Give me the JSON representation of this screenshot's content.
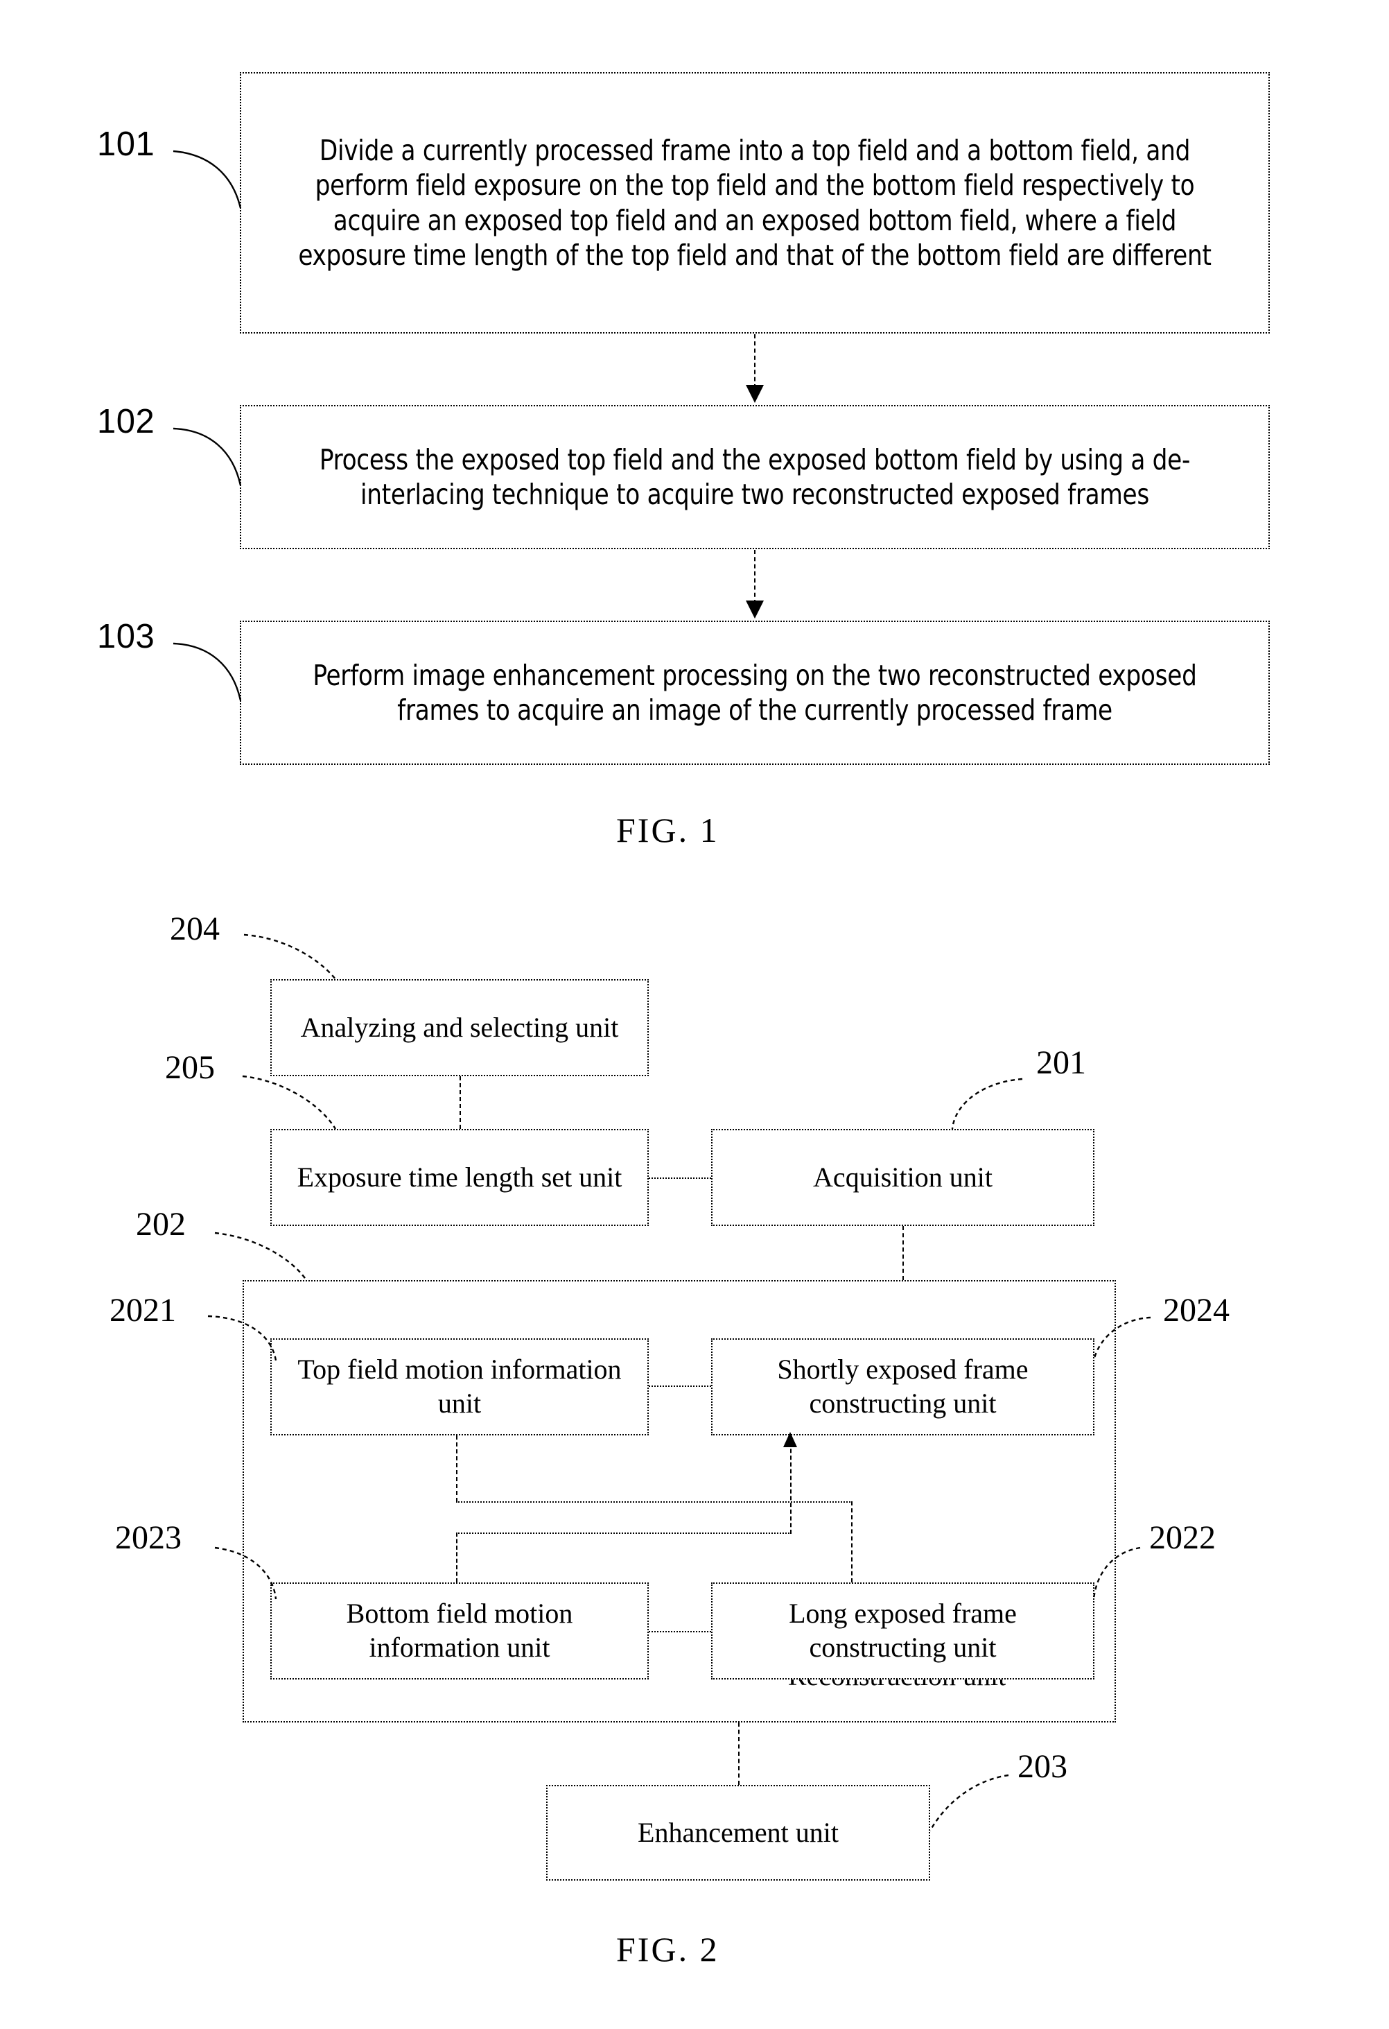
{
  "document": {
    "type": "patent-figure-sheet",
    "figures": [
      {
        "caption": "FIG. 1",
        "kind": "flowchart",
        "steps": [
          {
            "ref": "101",
            "text": "Divide a currently processed frame into a top field and a bottom field, and perform field exposure on the top field and the bottom field respectively to acquire an exposed top field and an exposed bottom field, where a field exposure time length of the top field and that of the bottom field are different"
          },
          {
            "ref": "102",
            "text": "Process the exposed top field and the exposed bottom field by using a de-interlacing technique to acquire two reconstructed exposed frames"
          },
          {
            "ref": "103",
            "text": "Perform image enhancement processing on the two reconstructed exposed frames to acquire an image of the currently processed frame"
          }
        ]
      },
      {
        "caption": "FIG. 2",
        "kind": "block-diagram",
        "blocks": [
          {
            "ref": "204",
            "label": "Analyzing and selecting unit"
          },
          {
            "ref": "205",
            "label": "Exposure time length set unit"
          },
          {
            "ref": "201",
            "label": "Acquisition unit"
          },
          {
            "ref": "202",
            "label": "Reconstruction unit"
          },
          {
            "ref": "2021",
            "label": "Top field motion information unit"
          },
          {
            "ref": "2024",
            "label": "Shortly exposed frame constructing unit"
          },
          {
            "ref": "2023",
            "label": "Bottom field motion information unit"
          },
          {
            "ref": "2022",
            "label": "Long exposed frame constructing unit"
          },
          {
            "ref": "203",
            "label": "Enhancement unit"
          }
        ]
      }
    ]
  },
  "fig1": {
    "caption": "FIG. 1",
    "step1_ref": "101",
    "step1_text": "Divide a currently processed frame into a top field and a bottom field, and perform field exposure on the top field and the bottom field respectively to acquire an exposed top field and an exposed bottom field, where a field exposure time length of the top field and that of the bottom field are different",
    "step2_ref": "102",
    "step2_text": "Process the exposed top field and the exposed bottom field by using a de-interlacing technique to acquire two reconstructed exposed frames",
    "step3_ref": "103",
    "step3_text": "Perform image enhancement processing on the two reconstructed exposed frames to acquire an image of the currently processed frame"
  },
  "fig2": {
    "caption": "FIG. 2",
    "analyzing_ref": "204",
    "analyzing_label": "Analyzing and selecting unit",
    "exposure_ref": "205",
    "exposure_label": "Exposure time length set unit",
    "acquisition_ref": "201",
    "acquisition_label": "Acquisition unit",
    "reconstruction_ref": "202",
    "reconstruction_label": "Reconstruction unit",
    "topfield_ref": "2021",
    "topfield_label": "Top field motion information unit",
    "shortframe_ref": "2024",
    "shortframe_label": "Shortly exposed frame constructing unit",
    "bottomfield_ref": "2023",
    "bottomfield_label": "Bottom field motion information unit",
    "longframe_ref": "2022",
    "longframe_label": "Long exposed frame constructing unit",
    "enhancement_ref": "203",
    "enhancement_label": "Enhancement unit"
  },
  "colors": {
    "ink": "#000000",
    "paper": "#ffffff"
  }
}
